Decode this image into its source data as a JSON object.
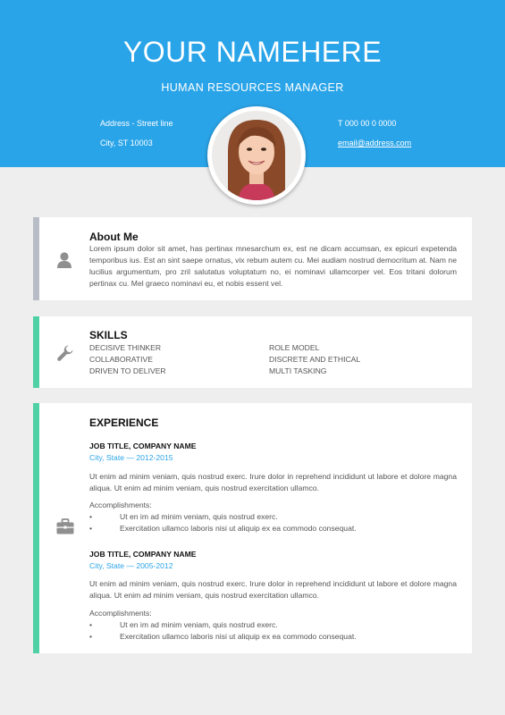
{
  "header": {
    "name": "YOUR NAMEHERE",
    "role": "HUMAN RESOURCES MANAGER",
    "address_line1": "Address - Street line",
    "address_line2": "City, ST 10003",
    "phone": "T 000 00 0 0000",
    "email": "email@address.com"
  },
  "colors": {
    "header_blue": "#2aa4e8",
    "about_bar": "#b8bcc6",
    "accent_green": "#4fd1a5",
    "location_blue": "#2aa4e8"
  },
  "about": {
    "icon": "user-icon",
    "title": "About Me",
    "text": "Lorem ipsum dolor sit amet, has pertinax mnesarchum ex, est ne dicam accumsan, ex epicuri expetenda temporibus ius. Est an sint saepe ornatus, vix rebum autem cu. Mei audiam nostrud democritum at. Nam ne lucilius argumentum, pro zril salutatus voluptatum no, ei nominavi ullamcorper vel. Eos tritani dolorum pertinax cu. Mel graeco nominavi eu, et nobis essent vel."
  },
  "skills": {
    "icon": "wrench-icon",
    "title": "SKILLS",
    "left": [
      "DECISIVE THINKER",
      "COLLABORATIVE",
      "DRIVEN TO DELIVER"
    ],
    "right": [
      "ROLE MODEL",
      "DISCRETE AND ETHICAL",
      "MULTI TASKING"
    ]
  },
  "experience": {
    "icon": "briefcase-icon",
    "title": "EXPERIENCE",
    "jobs": [
      {
        "title": "JOB TITLE, COMPANY NAME",
        "location": "City, State — 2012-2015",
        "description": "Ut enim ad minim veniam, quis nostrud exerc. Irure dolor in reprehend incididunt ut labore et dolore magna aliqua. Ut enim ad minim veniam, quis nostrud exercitation ullamco.",
        "accomplishments_label": "Accomplishments:",
        "bullets": [
          "Ut en im ad minim veniam, quis nostrud exerc.",
          "Exercitation ullamco laboris nisi ut aliquip ex ea commodo consequat."
        ]
      },
      {
        "title": "JOB TITLE, COMPANY NAME",
        "location": "City, State — 2005-2012",
        "description": "Ut enim ad minim veniam, quis nostrud exerc. Irure dolor in reprehend incididunt ut labore et dolore magna aliqua. Ut enim ad minim veniam, quis nostrud exercitation ullamco.",
        "accomplishments_label": "Accomplishments:",
        "bullets": [
          "Ut en im ad minim veniam, quis nostrud exerc.",
          "Exercitation ullamco laboris nisi ut aliquip ex ea commodo consequat."
        ]
      }
    ],
    "bullet_symbol": "•"
  }
}
